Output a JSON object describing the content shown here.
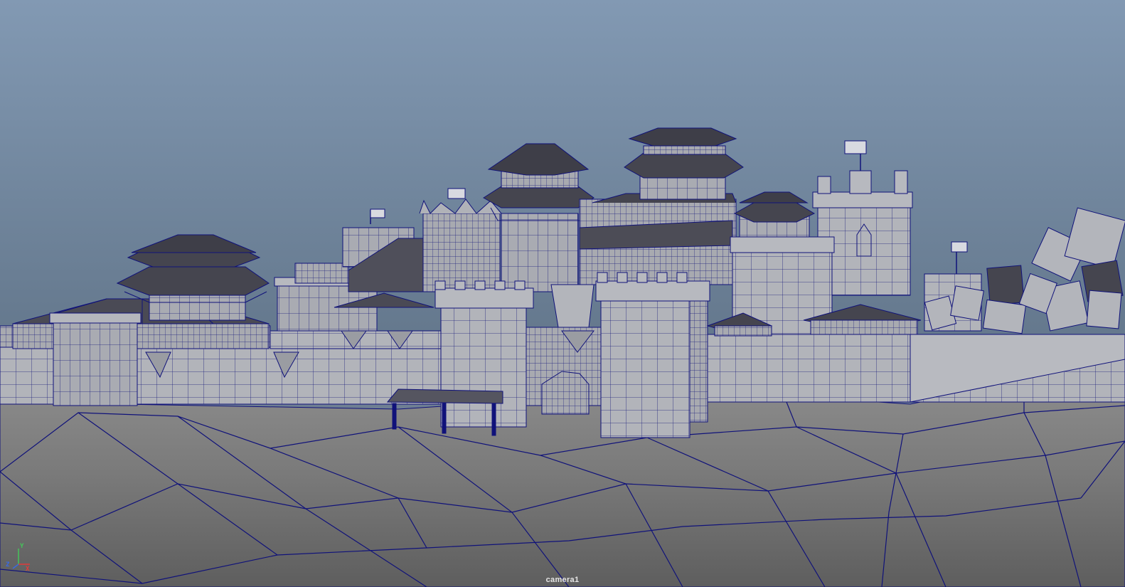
{
  "viewport": {
    "camera_label": "camera1",
    "axis": {
      "x_label": "X",
      "y_label": "Y",
      "z_label": "Z"
    },
    "colors": {
      "sky_top": "#8299b3",
      "sky_bottom": "#617488",
      "ground_far": "#8e8e8e",
      "ground_near": "#6a6a6a",
      "wire": "#10127a",
      "surface": "#aeb0b6",
      "surface_dark": "#3d3d46",
      "axis_x": "#e23a3a",
      "axis_y": "#45c45a",
      "axis_z": "#3a6ae2"
    }
  }
}
